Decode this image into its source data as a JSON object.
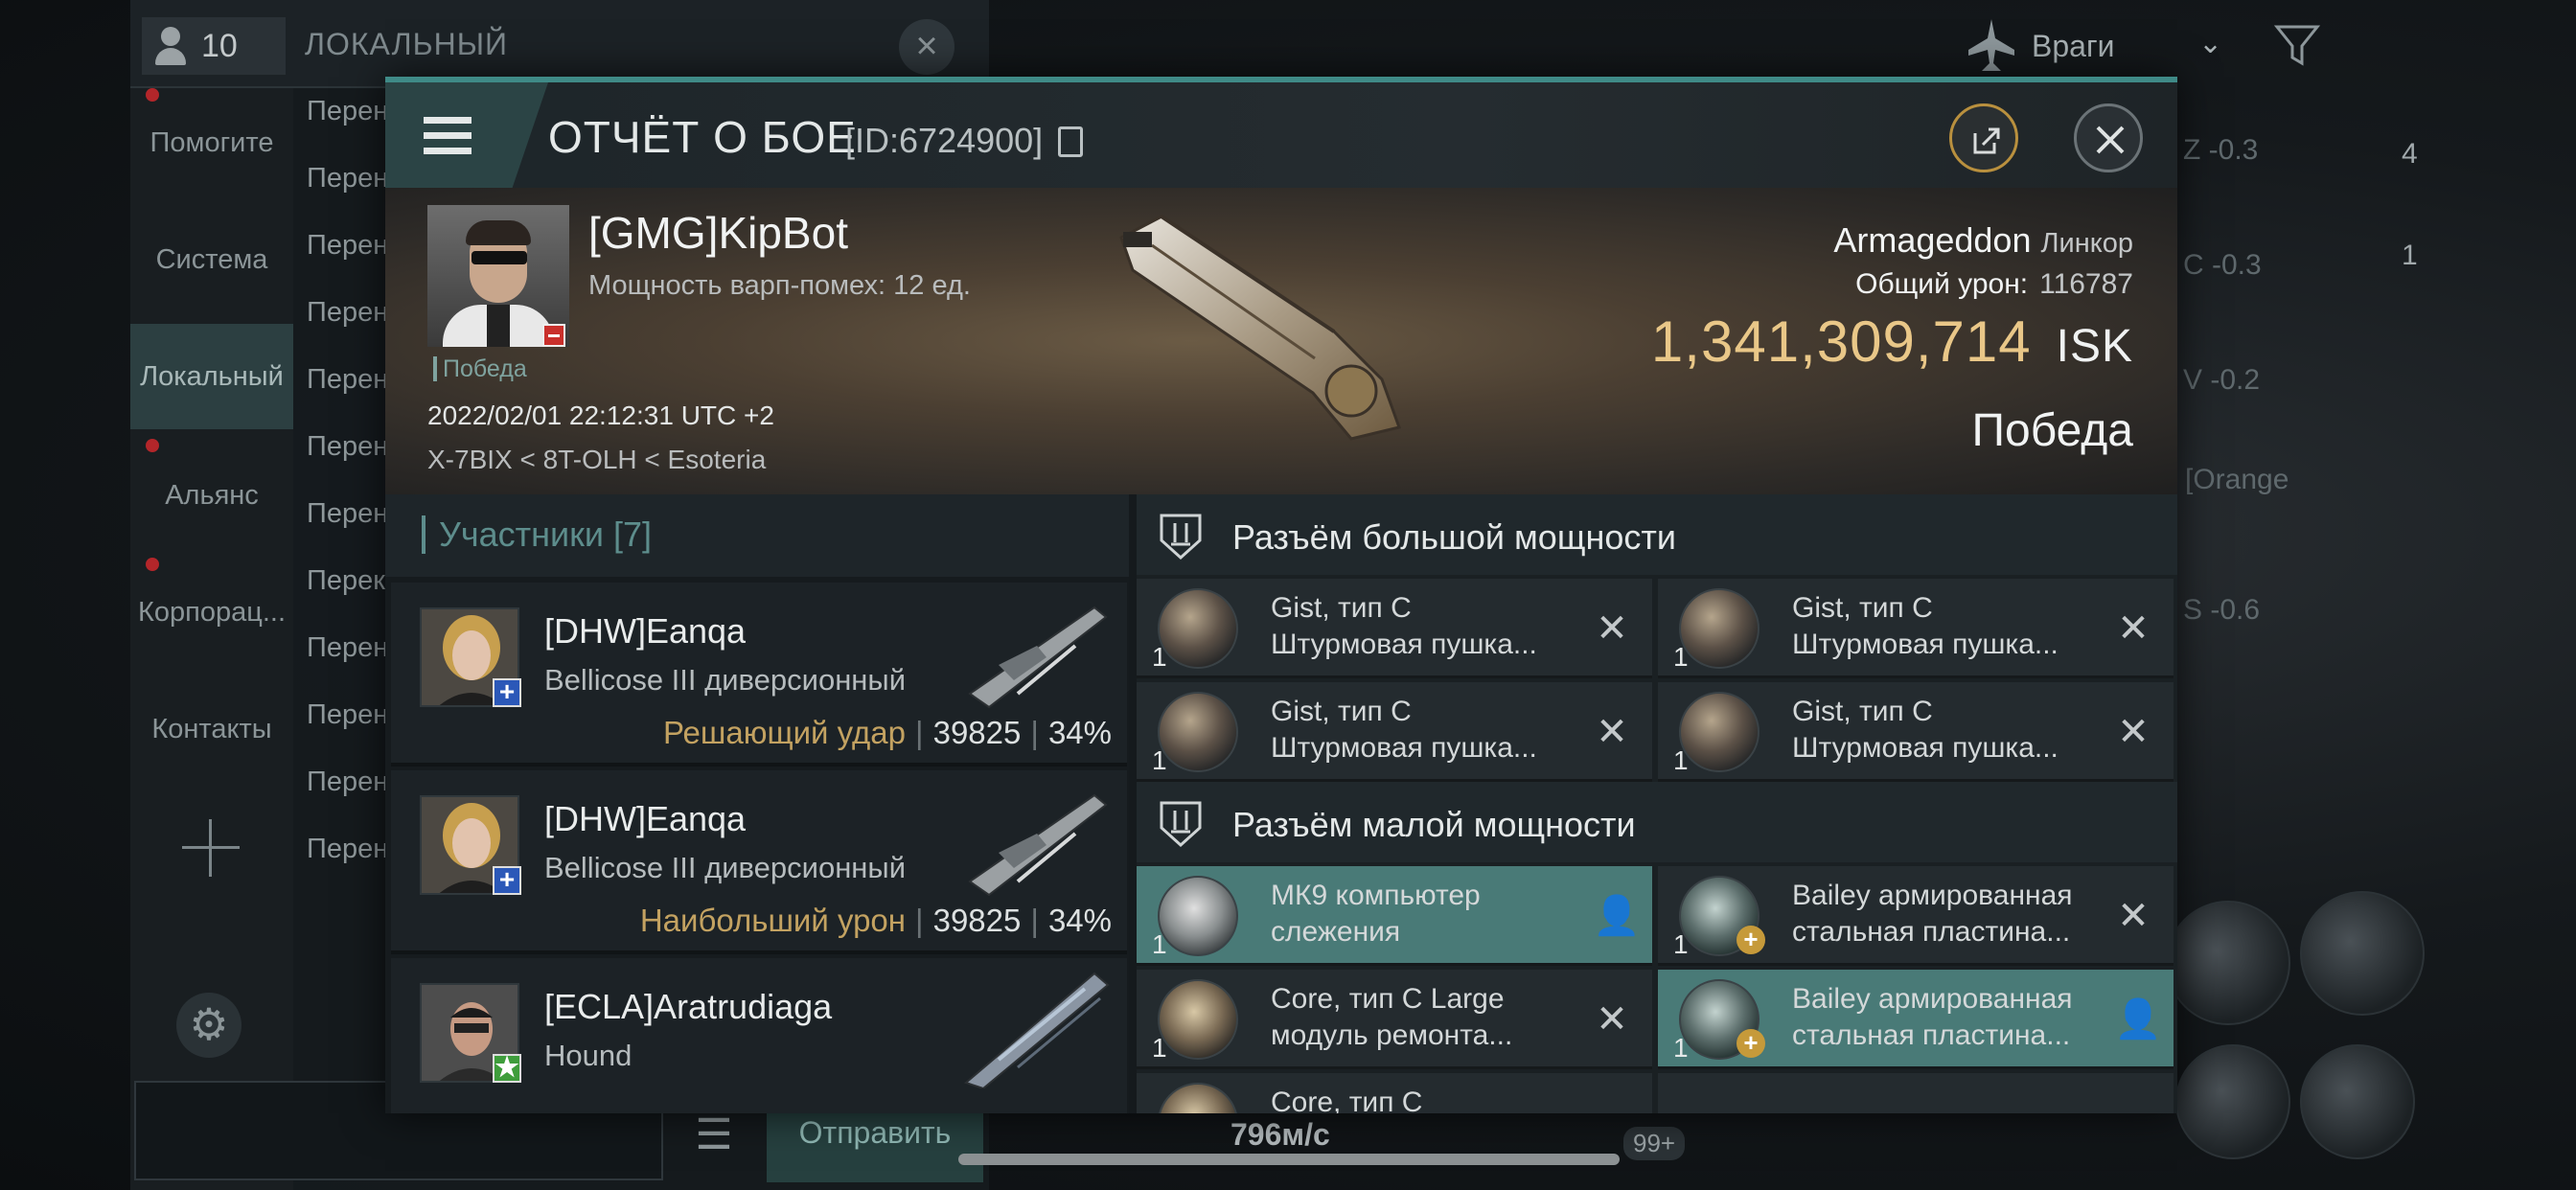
{
  "background": {
    "chat_count": "10",
    "channel_title": "ЛОКАЛЬНЫЙ",
    "sidebar": [
      "Помогите",
      "Система",
      "Локальный",
      "Альянс",
      "Корпорац...",
      "Контакты"
    ],
    "messages": [
      "Перен",
      "Перен",
      "Перен",
      "Перен",
      "Перен",
      "Перен",
      "Перен",
      "Перек",
      "Перен",
      "Перен",
      "Перен",
      "Перен"
    ],
    "send_label": "Отправить",
    "speed": "796м/с",
    "badge": "99+",
    "enemy_filter": "Враги",
    "right_values": [
      "Z -0.3",
      "C -0.3",
      "V -0.2",
      "[Orange",
      "S -0.6"
    ],
    "right_counts": [
      "4",
      "1"
    ]
  },
  "modal": {
    "title": "ОТЧЁТ О БОЕ",
    "id": "[ID:6724900]",
    "banner": {
      "victory_tag": "Победа",
      "pilot_name": "[GMG]KipBot",
      "warp_strength": "Мощность варп-помех: 12 ед.",
      "datetime": "2022/02/01 22:12:31 UTC +2",
      "location": "X-7BIX < 8T-OLH < Esoteria",
      "ship_name": "Armageddon",
      "ship_class": "Линкор",
      "total_damage_label": "Общий урон:",
      "total_damage": "116787",
      "isk_value": "1,341,309,714",
      "isk_unit": "ISK",
      "result": "Победа"
    },
    "participants_header": "Участники [7]",
    "participants": [
      {
        "name": "[DHW]Eanqa",
        "ship": "Bellicose III диверсионный",
        "tag": "Решающий удар",
        "damage": "39825",
        "percent": "34%",
        "badge": "+"
      },
      {
        "name": "[DHW]Eanqa",
        "ship": "Bellicose III диверсионный",
        "tag": "Наибольший урон",
        "damage": "39825",
        "percent": "34%",
        "badge": "+"
      },
      {
        "name": "[ECLA]Aratrudiaga",
        "ship": "Hound",
        "tag": "",
        "damage": "",
        "percent": "",
        "badge": "★"
      }
    ],
    "high_slots_header": "Разъём большой мощности",
    "high_slots": [
      {
        "qty": "1",
        "line1": "Gist, тип C",
        "line2": "Штурмовая пушка..."
      },
      {
        "qty": "1",
        "line1": "Gist, тип C",
        "line2": "Штурмовая пушка..."
      },
      {
        "qty": "1",
        "line1": "Gist, тип C",
        "line2": "Штурмовая пушка..."
      },
      {
        "qty": "1",
        "line1": "Gist, тип C",
        "line2": "Штурмовая пушка..."
      }
    ],
    "low_slots_header": "Разъём малой мощности",
    "low_slots": [
      {
        "qty": "1",
        "line1": "МК9 компьютер",
        "line2": "слежения"
      },
      {
        "qty": "1",
        "line1": "Bailey армированная",
        "line2": "стальная пластина..."
      },
      {
        "qty": "1",
        "line1": "Core, тип C Large",
        "line2": "модуль ремонта..."
      },
      {
        "qty": "1",
        "line1": "Bailey армированная",
        "line2": "стальная пластина..."
      }
    ],
    "partial_slot": "Core, тип C"
  }
}
